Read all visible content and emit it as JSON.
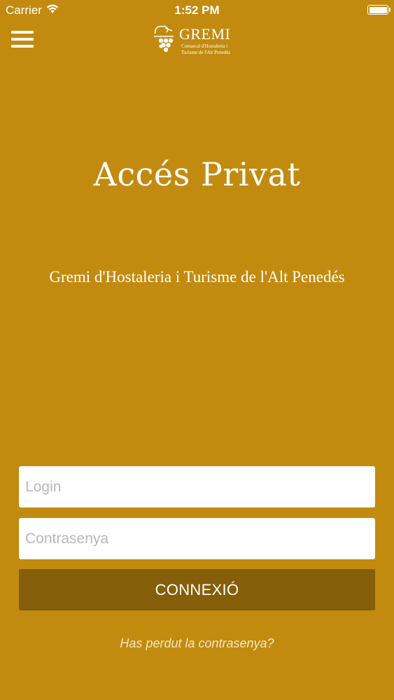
{
  "status_bar": {
    "carrier": "Carrier",
    "time": "1:52 PM",
    "icons": [
      "wifi-icon",
      "battery-icon"
    ]
  },
  "nav": {
    "menu_icon": "hamburger-menu-icon",
    "logo": {
      "title": "GREMI",
      "line1": "Comarcal d'Hostaleria i",
      "line2": "Turisme de l'Alt Penedès"
    }
  },
  "page": {
    "title": "Accés Privat",
    "subtitle": "Gremi d'Hostaleria i Turisme de l'Alt Penedés"
  },
  "form": {
    "login_placeholder": "Login",
    "login_value": "",
    "password_placeholder": "Contrasenya",
    "password_value": "",
    "submit_label": "CONNEXIÓ",
    "forgot_link": "Has perdut la contrasenya?"
  },
  "colors": {
    "background": "#c28b0f",
    "button": "#845e08",
    "text": "#ffffff"
  }
}
